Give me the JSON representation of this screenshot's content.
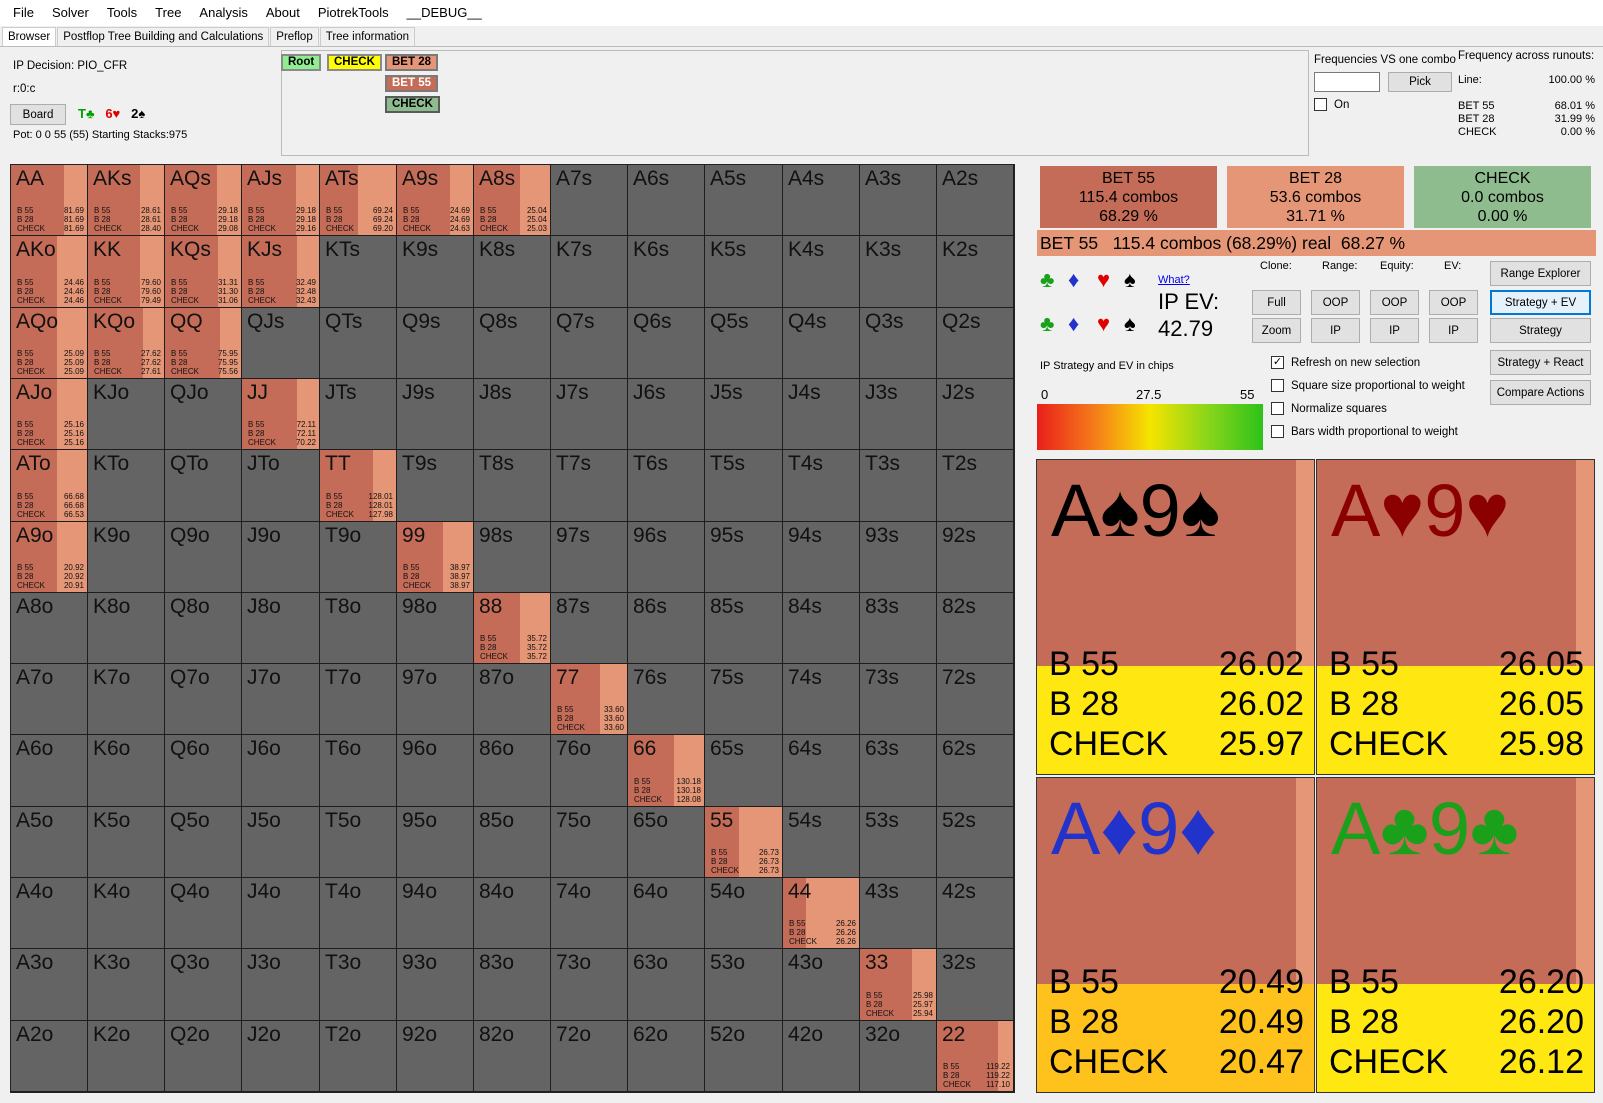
{
  "menu": [
    "File",
    "Solver",
    "Tools",
    "Tree",
    "Analysis",
    "About",
    "PiotrekTools",
    "__DEBUG__"
  ],
  "tabs": [
    "Browser",
    "Postflop Tree Building and Calculations",
    "Preflop",
    "Tree information"
  ],
  "info": {
    "decision": "IP Decision:  PIO_CFR",
    "node_path": "r:0:c",
    "board_button": "Board",
    "board_cards": [
      {
        "text": "T♣",
        "color": "#00a000"
      },
      {
        "text": "6♥",
        "color": "#e00000"
      },
      {
        "text": "2♠",
        "color": "#000000"
      }
    ],
    "pot": "Pot: 0 0 55 (55) Starting Stacks:975"
  },
  "tree": {
    "root": "Root",
    "check": "CHECK",
    "bet28": "BET 28",
    "bet55": "BET 55",
    "check2": "CHECK"
  },
  "freq_combo": {
    "title": "Frequencies VS one combo",
    "input_value": "",
    "pick": "Pick",
    "on_label": "On"
  },
  "freq_runouts": {
    "title": "Frequency across runouts:",
    "rows": [
      {
        "label": "Line:",
        "value": "100.00 %"
      },
      {
        "label": "BET 55",
        "value": "68.01 %"
      },
      {
        "label": "BET 28",
        "value": "31.99 %"
      },
      {
        "label": "CHECK",
        "value": "0.00 %"
      }
    ]
  },
  "colors": {
    "bet55": "#c46c58",
    "bet28": "#e59677",
    "check": "#8fbc8f",
    "empty": "#646464"
  },
  "grid": {
    "ranks": [
      "A",
      "K",
      "Q",
      "J",
      "T",
      "9",
      "8",
      "7",
      "6",
      "5",
      "4",
      "3",
      "2"
    ],
    "stat_labels": [
      "B 55",
      "B 28",
      "CHECK"
    ],
    "hands": {
      "AA": {
        "bet55": 0.7,
        "vals": [
          "81.69",
          "81.69",
          "81.69"
        ]
      },
      "AKs": {
        "bet55": 0.68,
        "vals": [
          "28.61",
          "28.61",
          "28.40"
        ]
      },
      "AQs": {
        "bet55": 0.68,
        "vals": [
          "29.18",
          "29.18",
          "29.08"
        ]
      },
      "AJs": {
        "bet55": 0.7,
        "vals": [
          "29.18",
          "29.18",
          "29.16"
        ]
      },
      "ATs": {
        "bet55": 0.5,
        "vals": [
          "69.24",
          "69.24",
          "69.20"
        ]
      },
      "A9s": {
        "bet55": 0.7,
        "vals": [
          "24.69",
          "24.69",
          "24.63"
        ]
      },
      "A8s": {
        "bet55": 0.6,
        "vals": [
          "25.04",
          "25.04",
          "25.03"
        ]
      },
      "AKo": {
        "bet55": 0.6,
        "vals": [
          "24.46",
          "24.46",
          "24.46"
        ]
      },
      "KK": {
        "bet55": 0.68,
        "vals": [
          "79.60",
          "79.60",
          "79.49"
        ]
      },
      "KQs": {
        "bet55": 0.7,
        "vals": [
          "31.31",
          "31.30",
          "31.06"
        ]
      },
      "KJs": {
        "bet55": 0.72,
        "vals": [
          "32.49",
          "32.48",
          "32.43"
        ]
      },
      "AQo": {
        "bet55": 0.6,
        "vals": [
          "25.09",
          "25.09",
          "25.09"
        ]
      },
      "KQo": {
        "bet55": 0.72,
        "vals": [
          "27.62",
          "27.62",
          "27.61"
        ]
      },
      "QQ": {
        "bet55": 0.72,
        "vals": [
          "75.95",
          "75.95",
          "75.56"
        ]
      },
      "AJo": {
        "bet55": 0.6,
        "vals": [
          "25.16",
          "25.16",
          "25.16"
        ]
      },
      "JJ": {
        "bet55": 0.72,
        "vals": [
          "72.11",
          "72.11",
          "70.22"
        ]
      },
      "ATo": {
        "bet55": 0.6,
        "vals": [
          "66.68",
          "66.68",
          "66.53"
        ]
      },
      "TT": {
        "bet55": 0.7,
        "vals": [
          "128.01",
          "128.01",
          "127.98"
        ]
      },
      "A9o": {
        "bet55": 0.6,
        "vals": [
          "20.92",
          "20.92",
          "20.91"
        ]
      },
      "99": {
        "bet55": 0.6,
        "vals": [
          "38.97",
          "38.97",
          "38.97"
        ]
      },
      "88": {
        "bet55": 0.6,
        "vals": [
          "35.72",
          "35.72",
          "35.72"
        ]
      },
      "77": {
        "bet55": 0.64,
        "vals": [
          "33.60",
          "33.60",
          "33.60"
        ]
      },
      "66": {
        "bet55": 0.6,
        "vals": [
          "130.18",
          "130.18",
          "128.08"
        ]
      },
      "55": {
        "bet55": 0.44,
        "vals": [
          "26.73",
          "26.73",
          "26.73"
        ]
      },
      "44": {
        "bet55": 0.3,
        "vals": [
          "26.26",
          "26.26",
          "26.26"
        ]
      },
      "33": {
        "bet55": 0.68,
        "vals": [
          "25.98",
          "25.97",
          "25.94"
        ]
      },
      "22": {
        "bet55": 0.8,
        "vals": [
          "119.22",
          "119.22",
          "117.10"
        ]
      }
    }
  },
  "actions": [
    {
      "name": "BET 55",
      "combos": "115.4 combos",
      "pct": "68.29 %",
      "color": "#c46c58"
    },
    {
      "name": "BET 28",
      "combos": "53.6 combos",
      "pct": "31.71 %",
      "color": "#e59677"
    },
    {
      "name": "CHECK",
      "combos": "0.0 combos",
      "pct": "0.00 %",
      "color": "#8fbc8f"
    }
  ],
  "selected_action": "BET 55   115.4 combos (68.29%) real  68.27 %",
  "suits": {
    "club": "♣",
    "diamond": "♦",
    "heart": "♥",
    "spade": "♠"
  },
  "what_link": "What?",
  "ev": {
    "label": "IP EV:",
    "value": "42.79"
  },
  "clone": {
    "title": "Clone:",
    "full": "Full",
    "zoom": "Zoom"
  },
  "range": {
    "title": "Range:",
    "oop": "OOP",
    "ip": "IP"
  },
  "equity": {
    "title": "Equity:",
    "oop": "OOP",
    "ip": "IP"
  },
  "evsel": {
    "title": "EV:",
    "oop": "OOP",
    "ip": "IP"
  },
  "view_buttons": [
    "Range Explorer",
    "Strategy + EV",
    "Strategy",
    "Strategy + React",
    "Compare Actions"
  ],
  "options": [
    {
      "label": "Refresh on new selection",
      "checked": true
    },
    {
      "label": "Square size proportional to weight",
      "checked": false
    },
    {
      "label": "Normalize squares",
      "checked": false
    },
    {
      "label": "Bars width proportional to weight",
      "checked": false
    }
  ],
  "legend": {
    "title": "IP Strategy and EV in chips",
    "min": "0",
    "mid": "27.5",
    "max": "55"
  },
  "combos": [
    {
      "rank1": "A",
      "suit": "♠",
      "rank2": "9",
      "color": "#000000",
      "band": "#ffe812",
      "rows": [
        {
          "a": "B 55",
          "v": "26.02"
        },
        {
          "a": "B 28",
          "v": "26.02"
        },
        {
          "a": "CHECK",
          "v": "25.97"
        }
      ]
    },
    {
      "rank1": "A",
      "suit": "♥",
      "rank2": "9",
      "color": "#8b0000",
      "band": "#ffe812",
      "rows": [
        {
          "a": "B 55",
          "v": "26.05"
        },
        {
          "a": "B 28",
          "v": "26.05"
        },
        {
          "a": "CHECK",
          "v": "25.98"
        }
      ]
    },
    {
      "rank1": "A",
      "suit": "♦",
      "rank2": "9",
      "color": "#2233cc",
      "band": "#ffc21c",
      "rows": [
        {
          "a": "B 55",
          "v": "20.49"
        },
        {
          "a": "B 28",
          "v": "20.49"
        },
        {
          "a": "CHECK",
          "v": "20.47"
        }
      ]
    },
    {
      "rank1": "A",
      "suit": "♣",
      "rank2": "9",
      "color": "#1aa01a",
      "band": "#ffe812",
      "rows": [
        {
          "a": "B 55",
          "v": "26.20"
        },
        {
          "a": "B 28",
          "v": "26.20"
        },
        {
          "a": "CHECK",
          "v": "26.12"
        }
      ]
    }
  ]
}
